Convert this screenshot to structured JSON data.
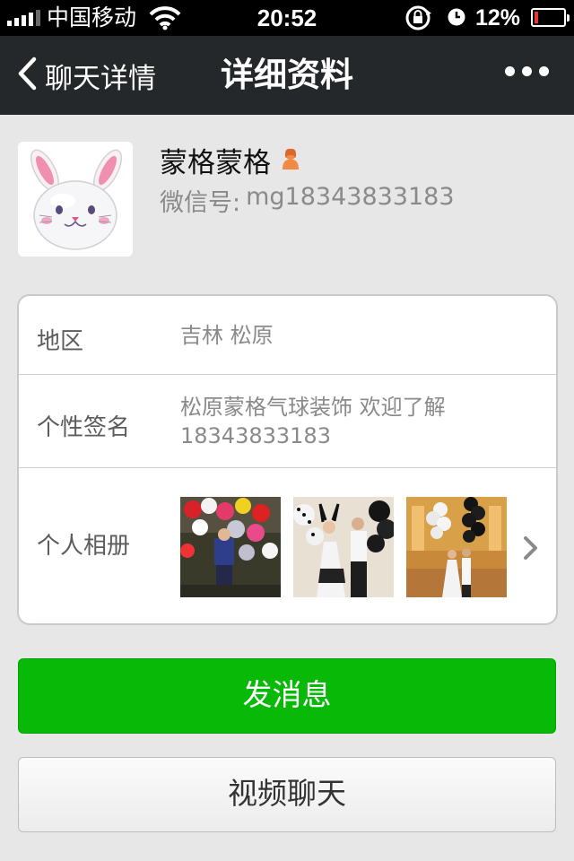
{
  "status_bar": {
    "carrier": "中国移动",
    "time": "20:52",
    "battery_percent": "12%",
    "battery_level": 0.12,
    "signal_bars": 4,
    "icons": [
      "signal-icon",
      "wifi-icon",
      "rotation-lock-icon",
      "alarm-icon",
      "battery-icon"
    ]
  },
  "nav": {
    "back_label": "聊天详情",
    "title": "详细资料",
    "more_icon": "more-dots-icon"
  },
  "profile": {
    "nickname": "蒙格蒙格",
    "gender_icon": "female-icon",
    "wechat_id_label": "微信号:",
    "wechat_id": "mg18343833183",
    "avatar_icon": "bunny-balloon-avatar"
  },
  "info": {
    "region_label": "地区",
    "region_value": "吉林 松原",
    "signature_label": "个性签名",
    "signature_value": "松原蒙格气球装饰 欢迎了解 18343833183",
    "album_label": "个人相册",
    "album_icon": "chevron-right-icon"
  },
  "buttons": {
    "send_message": "发消息",
    "video_chat": "视频聊天"
  },
  "colors": {
    "nav_bg": "#25282b",
    "page_bg": "#e7e7e7",
    "send_button": "#08b908",
    "battery_low": "#ee3333"
  }
}
